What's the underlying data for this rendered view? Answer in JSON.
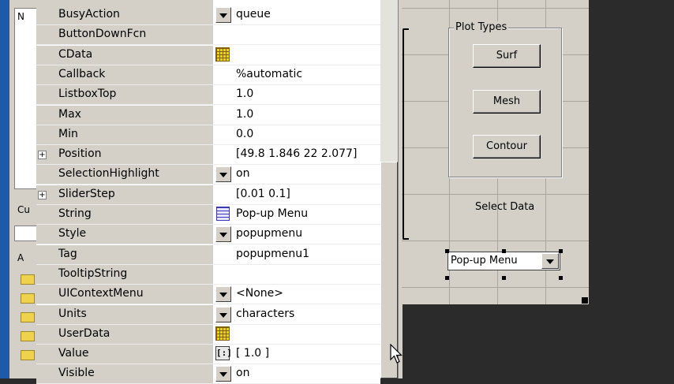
{
  "left_panel": {
    "tab_top": "N",
    "tab_mid": "Cu",
    "tab_low": "A"
  },
  "properties": [
    {
      "name": "BusyAction",
      "value": "queue",
      "control": "dropdown",
      "expander": false
    },
    {
      "name": "ButtonDownFcn",
      "value": "",
      "control": "none",
      "expander": false
    },
    {
      "name": "CData",
      "value": "",
      "control": "grid-icon",
      "expander": false
    },
    {
      "name": "Callback",
      "value": "%automatic",
      "control": "none",
      "expander": false
    },
    {
      "name": "ListboxTop",
      "value": "1.0",
      "control": "none",
      "expander": false
    },
    {
      "name": "Max",
      "value": "1.0",
      "control": "none",
      "expander": false
    },
    {
      "name": "Min",
      "value": "0.0",
      "control": "none",
      "expander": false
    },
    {
      "name": "Position",
      "value": "[49.8 1.846 22 2.077]",
      "control": "none",
      "expander": true
    },
    {
      "name": "SelectionHighlight",
      "value": "on",
      "control": "dropdown",
      "expander": false
    },
    {
      "name": "SliderStep",
      "value": "[0.01 0.1]",
      "control": "none",
      "expander": true
    },
    {
      "name": "String",
      "value": "Pop-up Menu",
      "control": "list-icon",
      "expander": false
    },
    {
      "name": "Style",
      "value": "popupmenu",
      "control": "dropdown",
      "expander": false
    },
    {
      "name": "Tag",
      "value": "popupmenu1",
      "control": "none",
      "expander": false
    },
    {
      "name": "TooltipString",
      "value": "",
      "control": "none",
      "expander": false
    },
    {
      "name": "UIContextMenu",
      "value": "<None>",
      "control": "dropdown",
      "expander": false
    },
    {
      "name": "Units",
      "value": "characters",
      "control": "dropdown",
      "expander": false
    },
    {
      "name": "UserData",
      "value": "",
      "control": "grid-icon",
      "expander": false
    },
    {
      "name": "Value",
      "value": "[ 1.0 ]",
      "control": "bracket-icon",
      "expander": false
    },
    {
      "name": "Visible",
      "value": "on",
      "control": "dropdown",
      "expander": false
    }
  ],
  "canvas": {
    "panel_title": "Plot Types",
    "buttons": [
      "Surf",
      "Mesh",
      "Contour"
    ],
    "select_label": "Select Data",
    "popup_value": "Pop-up Menu"
  },
  "colors": {
    "canvas_bg": "#d4d0c8",
    "name_column_bg": "#d4d0c8",
    "value_column_bg": "#ffffff",
    "workspace_bg": "#2b2b2b"
  }
}
